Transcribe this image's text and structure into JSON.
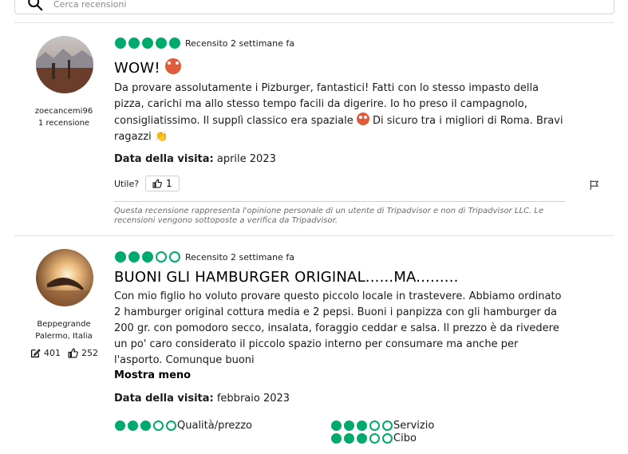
{
  "search": {
    "placeholder": "Cerca recensioni"
  },
  "reviews": [
    {
      "username": "zoecancemi96",
      "contributions": "1 recensione",
      "rating": 5,
      "reviewed": "Recensito 2 settimane fa",
      "title": "WOW!",
      "body": "Da provare assolutamente i Pizburger, fantastici! Fatti con lo stesso impasto della pizza, carichi ma allo stesso tempo facili da digerire. Io ho preso il campagnolo, consigliatissimo. Il supplì classico era spaziale",
      "body_tail": "Di sicuro tra i migliori di Roma. Bravi ragazzi",
      "visit_label": "Data della visita:",
      "visit_value": "aprile 2023",
      "useful_label": "Utile?",
      "useful_count": "1",
      "disclaimer": "Questa recensione rappresenta l'opinione personale di un utente di Tripadvisor e non di Tripadvisor LLC. Le recensioni vengono sottoposte a verifica da Tripadvisor."
    },
    {
      "username": "Beppegrande",
      "location": "Palermo, Italia",
      "contributions_count": "401",
      "helpful_votes": "252",
      "rating": 3,
      "reviewed": "Recensito 2 settimane fa",
      "title": "BUONI GLI HAMBURGER ORIGINAL......MA.........",
      "body": "Con mio figlio ho voluto provare questo piccolo locale in trastevere. Abbiamo ordinato 2 hamburger original cottura media e 2 pepsi. Buoni i panpizza con gli hamburger da 200 gr. con pomodoro secco, insalata, foraggio ceddar e salsa. Il prezzo è da rivedere un po' caro considerato il piccolo spazio interno per consumare ma anche per l'asporto. Comunque buoni",
      "show_less": "Mostra meno",
      "visit_label": "Data della visita:",
      "visit_value": "febbraio 2023",
      "subratings": [
        {
          "label": "Qualità/prezzo",
          "rating": 3
        },
        {
          "label": "Servizio",
          "rating": 3
        },
        {
          "label": "Cibo",
          "rating": 3
        }
      ]
    }
  ],
  "colors": {
    "bubble": "#00aa6c"
  }
}
